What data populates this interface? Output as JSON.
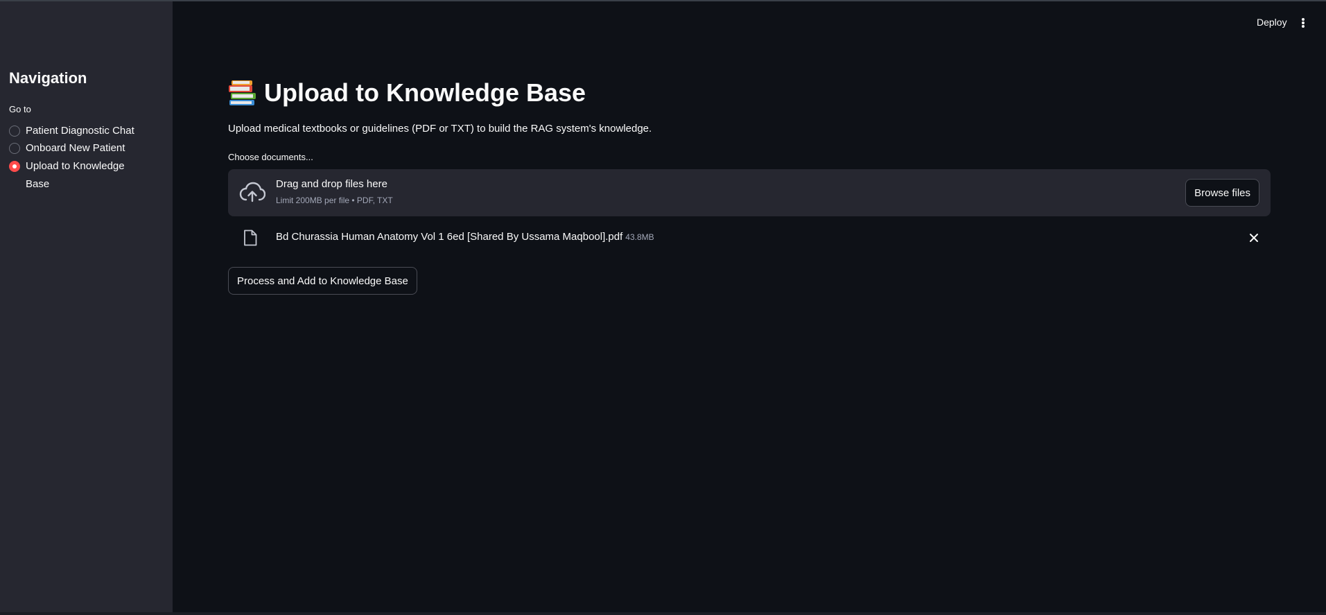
{
  "header": {
    "deploy_label": "Deploy",
    "menu_icon": "kebab-menu-icon"
  },
  "sidebar": {
    "title": "Navigation",
    "radio_label": "Go to",
    "options": [
      {
        "label": "Patient Diagnostic Chat",
        "selected": false
      },
      {
        "label": "Onboard New Patient",
        "selected": false
      },
      {
        "label": "Upload to Knowledge Base",
        "selected": true
      }
    ]
  },
  "main": {
    "title_icon": "books-icon",
    "title": "Upload to Knowledge Base",
    "description": "Upload medical textbooks or guidelines (PDF or TXT) to build the RAG system's knowledge.",
    "uploader": {
      "label": "Choose documents...",
      "drop_text": "Drag and drop files here",
      "limit_text": "Limit 200MB per file • PDF, TXT",
      "browse_label": "Browse files",
      "icon": "cloud-upload-icon"
    },
    "files": [
      {
        "name": "Bd Churassia Human Anatomy Vol 1 6ed [Shared By Ussama Maqbool].pdf",
        "size": "43.8MB"
      }
    ],
    "process_label": "Process and Add to Knowledge Base"
  },
  "colors": {
    "background": "#0e1117",
    "sidebar": "#262730",
    "accent": "#ff4b4b",
    "text": "#fafafa",
    "muted": "#a3a8b8"
  }
}
